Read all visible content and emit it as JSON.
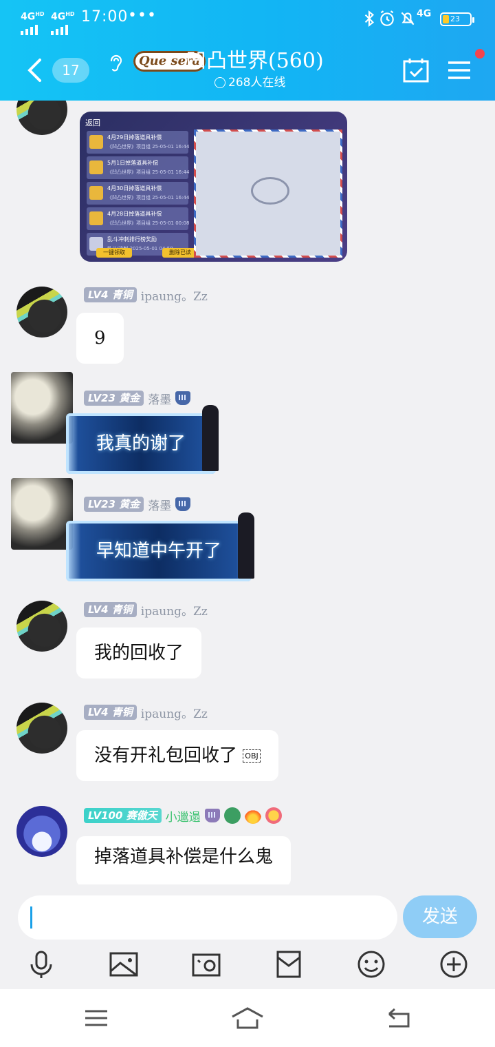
{
  "status": {
    "net1": "4G",
    "net1_sup": "HD",
    "net2": "4G",
    "net2_sup": "HD",
    "time": "17:00",
    "dots": "•••",
    "net_type": "4G",
    "battery": "23"
  },
  "header": {
    "unread": "17",
    "brand": "Que sera",
    "title": "凹凸世界(560)",
    "online": "268人在线"
  },
  "messages": [
    {
      "type": "image",
      "avatar": "robot",
      "image": {
        "back": "返回",
        "rows": [
          {
            "title": "4月29日掉落道具补偿",
            "sub": "《凹凸世界》项目组 25-05-01 16:44"
          },
          {
            "title": "5月1日掉落道具补偿",
            "sub": "《凹凸世界》项目组 25-05-01 16:44"
          },
          {
            "title": "4月30日掉落道具补偿",
            "sub": "《凹凸世界》项目组 25-05-01 16:44"
          },
          {
            "title": "4月28日掉落道具补偿",
            "sub": "《凹凸世界》项目组 25-05-01 00:08"
          },
          {
            "title": "乱斗冲刺排行榜奖励",
            "sub": "乱斗/冲刺 2025-05-01 04:58"
          }
        ],
        "btn1": "一键领取",
        "btn2": "删除已读"
      }
    },
    {
      "level": "LV4",
      "rank": "青铜",
      "nick": "ipaung。Zz",
      "text": "9"
    },
    {
      "level": "LV23",
      "rank": "黄金",
      "nick": "落墨",
      "text": "我真的谢了"
    },
    {
      "level": "LV23",
      "rank": "黄金",
      "nick": "落墨",
      "text": "早知道中午开了"
    },
    {
      "level": "LV4",
      "rank": "青铜",
      "nick": "ipaung。Zz",
      "text": "我的回收了"
    },
    {
      "level": "LV4",
      "rank": "青铜",
      "nick": "ipaung。Zz",
      "text": "没有开礼包回收了",
      "obj": "OBJ"
    },
    {
      "level": "LV100",
      "rank": "赛傲天",
      "nick": "小邋遢",
      "text": "掉落道具补偿是什么鬼"
    }
  ],
  "composer": {
    "placeholder": "",
    "send": "发送"
  },
  "icons": {
    "back": "chevron-left-icon",
    "ear": "ear-icon",
    "calendar": "calendar-check-icon",
    "menu": "menu-icon",
    "tools": [
      "microphone-icon",
      "image-icon",
      "camera-icon",
      "red-packet-icon",
      "emoji-icon",
      "plus-icon"
    ],
    "system": [
      "recent-apps-icon",
      "home-icon",
      "back-icon"
    ]
  },
  "colors": {
    "header": "#15c4f5",
    "send": "#8fcdf6",
    "level_grey": "#a7aec3",
    "level_teal": "#3bd1c9"
  }
}
